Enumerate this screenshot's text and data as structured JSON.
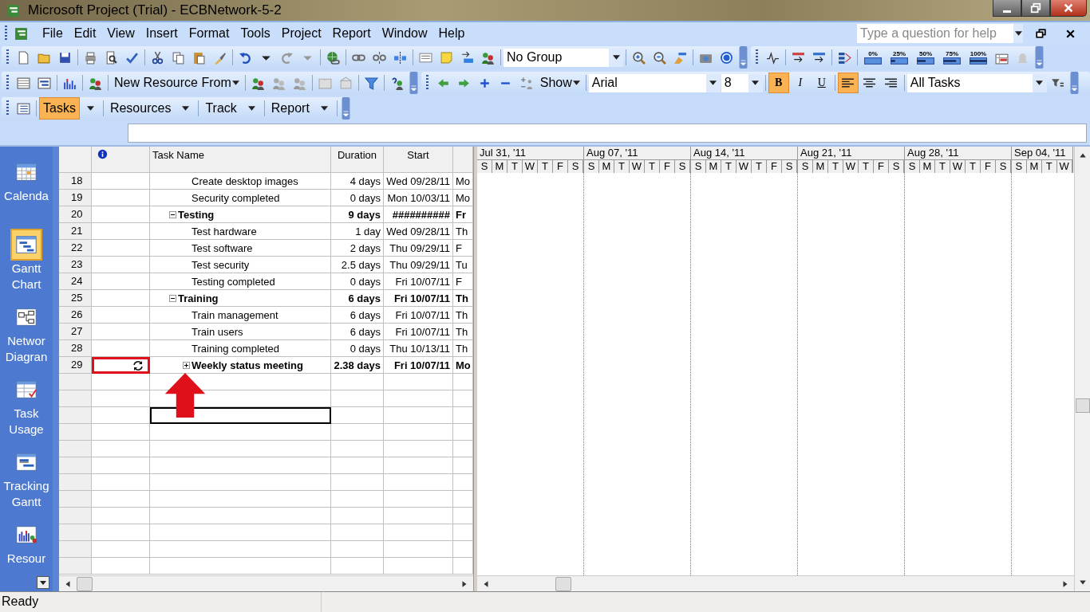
{
  "window": {
    "title": "Microsoft Project (Trial) - ECBNetwork-5-2"
  },
  "menu": [
    "File",
    "Edit",
    "View",
    "Insert",
    "Format",
    "Tools",
    "Project",
    "Report",
    "Window",
    "Help"
  ],
  "help_search": {
    "placeholder": "Type a question for help"
  },
  "standard_toolbar": {
    "group_combo": "No Group"
  },
  "tracking_toolbar": {
    "progress_buttons": [
      "0%",
      "25%",
      "50%",
      "75%",
      "100%"
    ]
  },
  "resource_toolbar": {
    "new_resource_button": "New Resource From"
  },
  "formatting_toolbar": {
    "show_button": "Show",
    "font": "Arial",
    "size": "8",
    "style_buttons": [
      {
        "label": "B",
        "kind": "bold",
        "on": true
      },
      {
        "label": "I",
        "kind": "italic",
        "on": false
      },
      {
        "label": "U",
        "kind": "underline",
        "on": false
      }
    ],
    "alignments": [
      {
        "kind": "left",
        "selected": true
      },
      {
        "kind": "center",
        "selected": false
      },
      {
        "kind": "right",
        "selected": false
      }
    ],
    "filter": "All Tasks"
  },
  "guide_toolbar": {
    "tabs": [
      {
        "label": "Tasks",
        "selected": true
      },
      {
        "label": "Resources",
        "selected": false
      },
      {
        "label": "Track",
        "selected": false
      },
      {
        "label": "Report",
        "selected": false
      }
    ]
  },
  "view_bar": {
    "items": [
      {
        "label": "Calenda",
        "kind": "calendar",
        "selected": false
      },
      {
        "label": "Gantt Chart",
        "kind": "gantt",
        "selected": true
      },
      {
        "label": "Networ Diagran",
        "kind": "network",
        "selected": false
      },
      {
        "label": "Task Usage",
        "kind": "usage",
        "selected": false
      },
      {
        "label": "Tracking Gantt",
        "kind": "tracking",
        "selected": false
      },
      {
        "label": "Resour",
        "kind": "resource",
        "selected": false
      }
    ]
  },
  "table": {
    "columns": [
      "Task Name",
      "Duration",
      "Start"
    ],
    "rows": [
      {
        "children": [
          {
            "id": "18",
            "kind": "task",
            "name": "Create desktop images",
            "duration": "4 days",
            "start": "Wed 09/28/11",
            "finish": "Mo"
          },
          {
            "id": "19",
            "kind": "task",
            "name": "Security completed",
            "duration": "0 days",
            "start": "Mon 10/03/11",
            "finish": "Mo"
          }
        ]
      },
      {
        "id": "20",
        "kind": "summary",
        "expanded": true,
        "name": "Testing",
        "duration": "9 days",
        "start": "##########",
        "finish": "Fr",
        "children": [
          {
            "id": "21",
            "kind": "task",
            "name": "Test hardware",
            "duration": "1 day",
            "start": "Wed 09/28/11",
            "finish": "Th"
          },
          {
            "id": "22",
            "kind": "task",
            "name": "Test software",
            "duration": "2 days",
            "start": "Thu 09/29/11",
            "finish": "F"
          },
          {
            "id": "23",
            "kind": "task",
            "name": "Test security",
            "duration": "2.5 days",
            "start": "Thu 09/29/11",
            "finish": "Tu"
          },
          {
            "id": "24",
            "kind": "task",
            "name": "Testing completed",
            "duration": "0 days",
            "start": "Fri 10/07/11",
            "finish": "F"
          }
        ]
      },
      {
        "id": "25",
        "kind": "summary",
        "expanded": true,
        "name": "Training",
        "duration": "6 days",
        "start": "Fri 10/07/11",
        "finish": "Th",
        "children": [
          {
            "id": "26",
            "kind": "task",
            "name": "Train management",
            "duration": "6 days",
            "start": "Fri 10/07/11",
            "finish": "Th"
          },
          {
            "id": "27",
            "kind": "task",
            "name": "Train users",
            "duration": "6 days",
            "start": "Fri 10/07/11",
            "finish": "Th"
          },
          {
            "id": "28",
            "kind": "task",
            "name": "Training completed",
            "duration": "0 days",
            "start": "Thu 10/13/11",
            "finish": "Th"
          },
          {
            "id": "29",
            "kind": "recurring",
            "expanded": false,
            "marked": true,
            "name": "Weekly status meeting",
            "duration": "2.38 days",
            "start": "Fri 10/07/11",
            "finish": "Mo"
          }
        ]
      }
    ],
    "empty_rows": [
      {
        "selected": false
      },
      {
        "selected": false
      },
      {
        "selected": true
      },
      {
        "selected": false
      },
      {
        "selected": false
      },
      {
        "selected": false
      },
      {
        "selected": false
      },
      {
        "selected": false
      },
      {
        "selected": false
      },
      {
        "selected": false
      },
      {
        "selected": false
      },
      {
        "selected": false
      }
    ]
  },
  "timescale": {
    "weeks": [
      {
        "label": "Jul 31, '11",
        "days": [
          "S",
          "M",
          "T",
          "W",
          "T",
          "F",
          "S"
        ]
      },
      {
        "label": "Aug 07, '11",
        "days": [
          "S",
          "M",
          "T",
          "W",
          "T",
          "F",
          "S"
        ]
      },
      {
        "label": "Aug 14, '11",
        "days": [
          "S",
          "M",
          "T",
          "W",
          "T",
          "F",
          "S"
        ]
      },
      {
        "label": "Aug 21, '11",
        "days": [
          "S",
          "M",
          "T",
          "W",
          "T",
          "F",
          "S"
        ]
      },
      {
        "label": "Aug 28, '11",
        "days": [
          "S",
          "M",
          "T",
          "W",
          "T",
          "F",
          "S"
        ]
      },
      {
        "label": "Sep 04, '11",
        "days": [
          "S",
          "M",
          "T",
          "W"
        ]
      }
    ]
  },
  "status_bar": {
    "text": "Ready"
  }
}
